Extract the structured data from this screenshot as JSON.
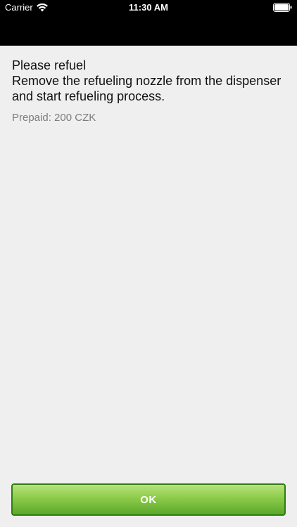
{
  "status_bar": {
    "carrier": "Carrier",
    "time": "11:30 AM",
    "icons": [
      "wifi-icon",
      "battery-icon"
    ]
  },
  "content": {
    "title": "Please refuel",
    "message": "Remove the refueling nozzle from the dispenser and start refueling process.",
    "prepaid": "Prepaid: 200 CZK"
  },
  "actions": {
    "ok_label": "OK"
  },
  "colors": {
    "background": "#efefef",
    "header": "#000000",
    "primary_button": "#5aa82b",
    "secondary_text": "#7d7d7d"
  }
}
